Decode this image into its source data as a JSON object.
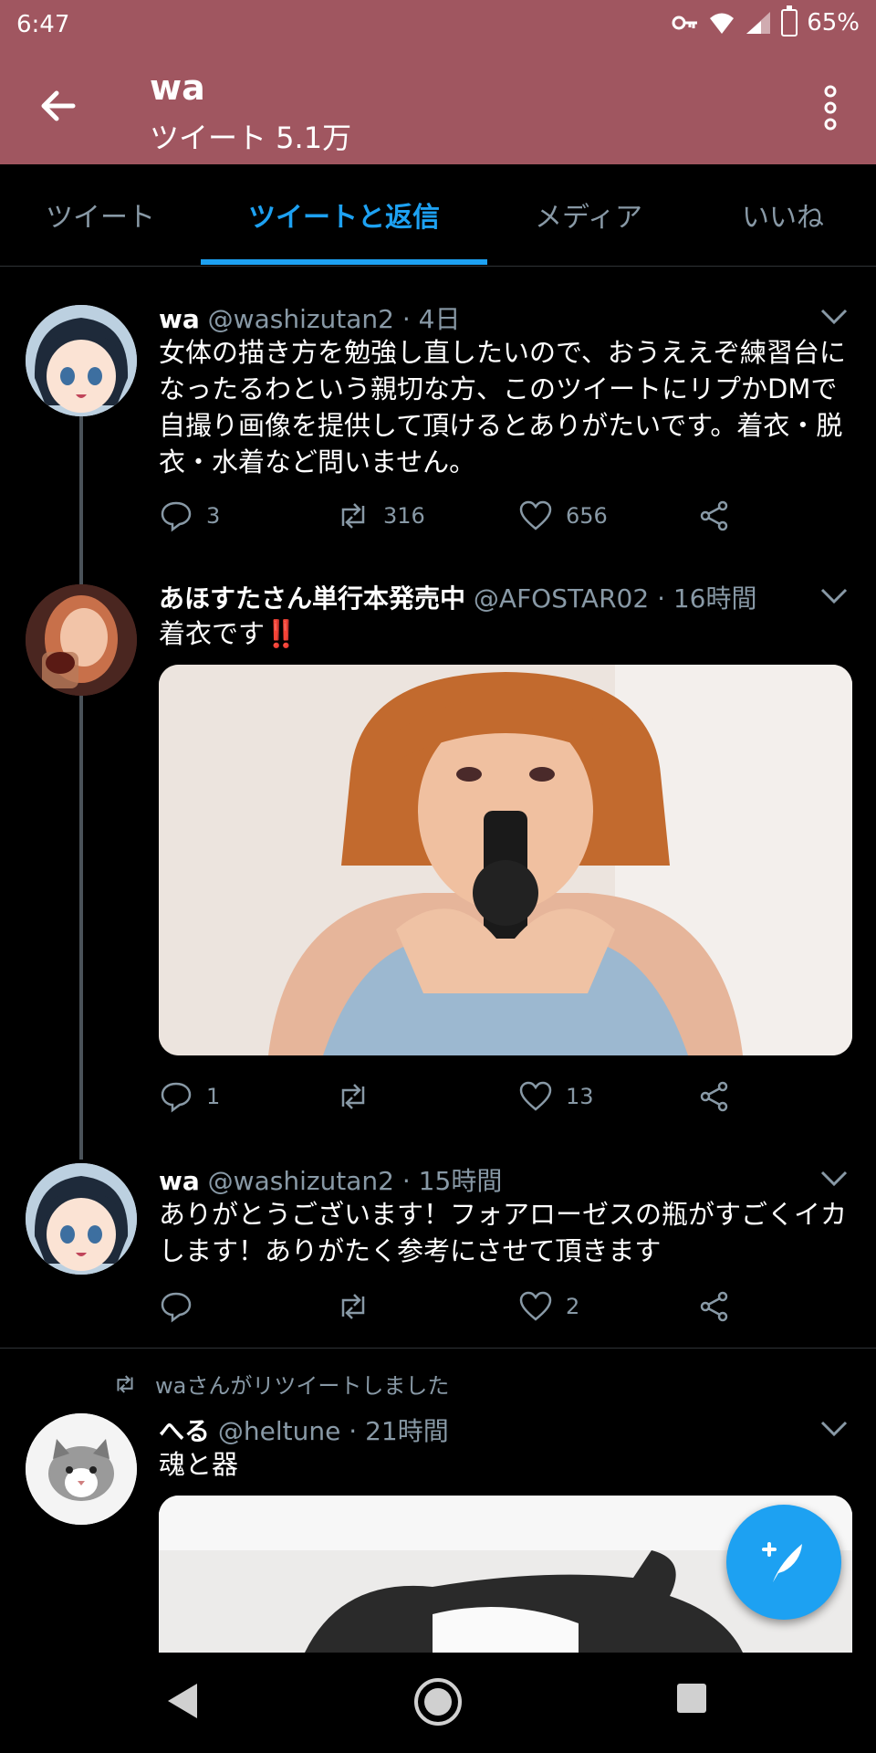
{
  "status_bar": {
    "time": "6:47",
    "battery": "65%"
  },
  "header": {
    "title": "wa",
    "subtitle": "ツイート 5.1万"
  },
  "tabs": [
    {
      "label": "ツイート",
      "active": false
    },
    {
      "label": "ツイートと返信",
      "active": true
    },
    {
      "label": "メディア",
      "active": false
    },
    {
      "label": "いいね",
      "active": false
    }
  ],
  "tweets": [
    {
      "name": "wa",
      "handle": "@washizutan2 · 4日",
      "text": "女体の描き方を勉強し直したいので、おうええぞ練習台になったるわという親切な方、このツイートにリプかDMで自撮り画像を提供して頂けるとありがたいです。着衣・脱衣・水着など問いません。",
      "replies": "3",
      "retweets": "316",
      "likes": "656"
    },
    {
      "name": "あほすたさん単行本発売中",
      "handle": "@AFOSTAR02 · 16時間",
      "text": "着衣です",
      "emoji": "‼️",
      "replies": "1",
      "retweets": "",
      "likes": "13"
    },
    {
      "name": "wa",
      "handle": "@washizutan2 · 15時間",
      "text": "ありがとうございます！フォアローゼスの瓶がすごくイカします！ありがたく参考にさせて頂きます",
      "replies": "",
      "retweets": "",
      "likes": "2"
    },
    {
      "retweeted_by": "waさんがリツイートしました",
      "name": "へる",
      "handle": "@heltune · 21時間",
      "text": "魂と器"
    }
  ],
  "colors": {
    "accent": "#1da1f2",
    "header_bg": "#a05660",
    "muted": "#8899a6"
  },
  "icons": [
    "back-arrow-icon",
    "more-vert-icon",
    "reply-icon",
    "retweet-icon",
    "like-icon",
    "share-icon",
    "compose-icon"
  ]
}
